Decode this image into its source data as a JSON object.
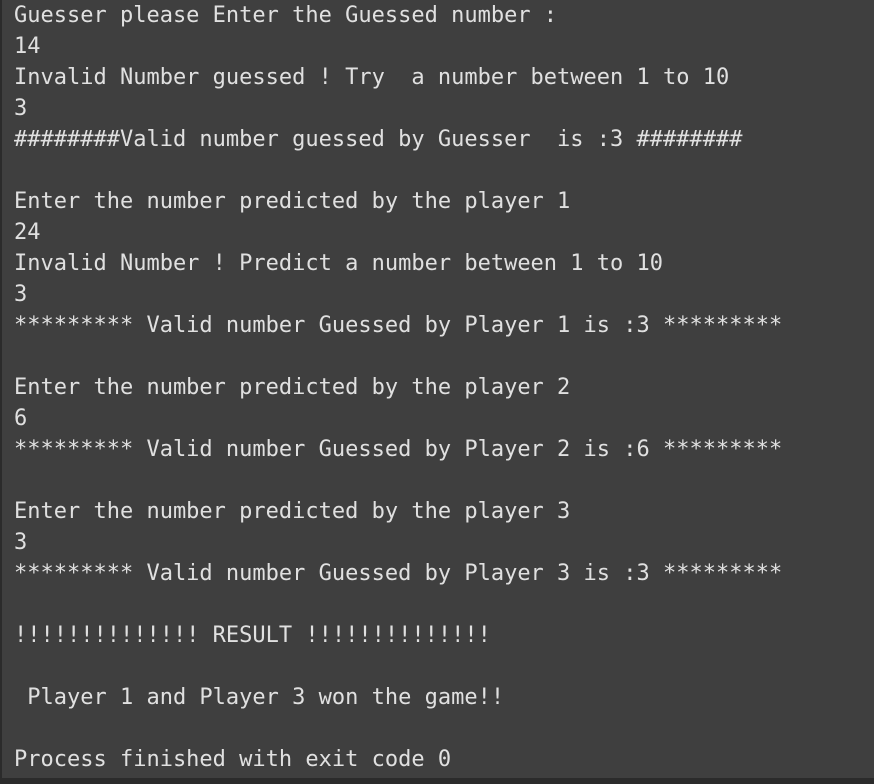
{
  "console": {
    "lines": [
      "Guesser please Enter the Guessed number :",
      "14",
      "Invalid Number guessed ! Try  a number between 1 to 10",
      "3",
      "########Valid number guessed by Guesser  is :3 ########",
      "",
      "Enter the number predicted by the player 1",
      "24",
      "Invalid Number ! Predict a number between 1 to 10",
      "3",
      "********* Valid number Guessed by Player 1 is :3 *********",
      "",
      "Enter the number predicted by the player 2",
      "6",
      "********* Valid number Guessed by Player 2 is :6 *********",
      "",
      "Enter the number predicted by the player 3",
      "3",
      "********* Valid number Guessed by Player 3 is :3 *********",
      "",
      "!!!!!!!!!!!!!! RESULT !!!!!!!!!!!!!!",
      "",
      " Player 1 and Player 3 won the game!!",
      "",
      "Process finished with exit code 0"
    ]
  }
}
